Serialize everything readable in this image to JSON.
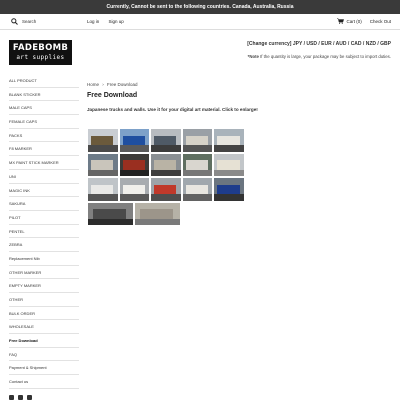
{
  "announcement": "Currently, Cannot be sent to the following countries. Canada, Australia, Russia",
  "search": {
    "placeholder": "Search"
  },
  "top_links": {
    "login": "Log in",
    "signup": "Sign up",
    "cart": "Cart (0)",
    "checkout": "Check Out"
  },
  "logo": {
    "line1": "FADEBOMB",
    "line2": "art supplies"
  },
  "currency": {
    "label": "[Change currency]",
    "options": [
      "JPY",
      "USD",
      "EUR",
      "AUD",
      "CAD",
      "NZD",
      "GBP"
    ],
    "sep": "/"
  },
  "note": {
    "bold": "*Note",
    "text": " If the quantity is large, your package may be subject to import duties."
  },
  "sidebar": {
    "items": [
      "ALL PRODUCT",
      "BLANK STICKER",
      "MALE CAPS",
      "FEMALE CAPS",
      "PACKS",
      "F8 MARKER",
      "MX PAINT STICK MARKER",
      "UNI",
      "MAGIC INK",
      "SAKURA",
      "PILOT",
      "PENTEL",
      "ZEBRA",
      "Replacement Nib",
      "OTHER MARKER",
      "EMPTY MARKER",
      "OTHER",
      "BULK ORDER",
      "WHOLESALE",
      "Free Download",
      "FAQ",
      "Payment & Shipment",
      "Contact us"
    ],
    "active_index": 19
  },
  "social_icons": [
    "facebook-icon",
    "instagram-icon",
    "youtube-icon"
  ],
  "breadcrumb": {
    "home": "Home",
    "sep": "›",
    "current": "Free Download"
  },
  "page_title": "Free Download",
  "description": "Japanese trucks and walls. Use it for your digital art material.  Click to enlarge!",
  "gallery": {
    "thumbs": [
      {
        "sky": "#c9cdd2",
        "mid": "#6b5a3c",
        "gnd": "#4a4a4a"
      },
      {
        "sky": "#7da1c9",
        "mid": "#1f4fa0",
        "gnd": "#5a5a5a"
      },
      {
        "sky": "#b8bcc0",
        "mid": "#4f5a66",
        "gnd": "#3c3c3c"
      },
      {
        "sky": "#9aa0a6",
        "mid": "#d6d2c8",
        "gnd": "#555"
      },
      {
        "sky": "#a9b3bb",
        "mid": "#e7e5df",
        "gnd": "#444"
      },
      {
        "sky": "#6d7b88",
        "mid": "#c9c5bb",
        "gnd": "#666"
      },
      {
        "sky": "#3d3b38",
        "mid": "#9a2f20",
        "gnd": "#222"
      },
      {
        "sky": "#8a8f93",
        "mid": "#b9b3a5",
        "gnd": "#3e3e3e"
      },
      {
        "sky": "#5f6f61",
        "mid": "#d9d6cf",
        "gnd": "#777"
      },
      {
        "sky": "#c2c6c9",
        "mid": "#e6e1d4",
        "gnd": "#8a8a8a"
      },
      {
        "sky": "#bfc4c8",
        "mid": "#e9e9e7",
        "gnd": "#555"
      },
      {
        "sky": "#a8acb0",
        "mid": "#f0efeb",
        "gnd": "#5a5a5a"
      },
      {
        "sky": "#9ea4a9",
        "mid": "#c0392b",
        "gnd": "#4e4e4e"
      },
      {
        "sky": "#a0a7ad",
        "mid": "#e8e6e0",
        "gnd": "#626262"
      },
      {
        "sky": "#6b7580",
        "mid": "#1e3c8c",
        "gnd": "#333"
      },
      {
        "sky": "#808080",
        "mid": "#4a4a4a",
        "gnd": "#2c2c2c"
      },
      {
        "sky": "#b6b2a7",
        "mid": "#9c958a",
        "gnd": "#7a7a7a"
      },
      {
        "sky": "#c7c7c5",
        "mid": "#8a8a88",
        "gnd": "#6a6a6a"
      }
    ]
  }
}
